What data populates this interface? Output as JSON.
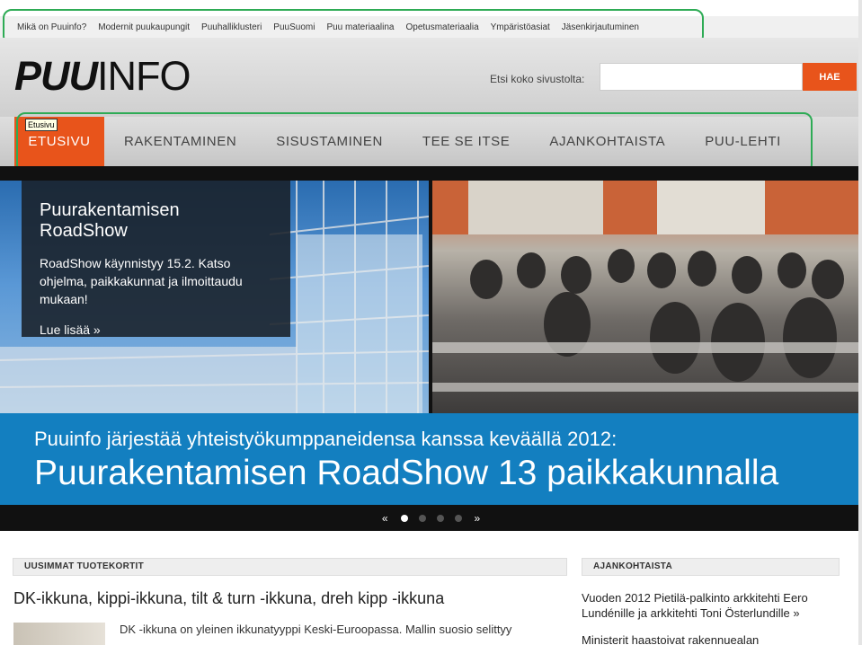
{
  "top_links": [
    "Mikä on Puuinfo?",
    "Modernit puukaupungit",
    "Puuhalliklusteri",
    "PuuSuomi",
    "Puu materiaalina",
    "Opetusmateriaalia",
    "Ympäristöasiat",
    "Jäsenkirjautuminen"
  ],
  "header": {
    "logo_part1": "PUU",
    "logo_part2": "INFO",
    "search_label": "Etsi koko sivustolta:",
    "search_value": "",
    "search_button": "HAE"
  },
  "main_nav": {
    "active": "ETUSIVU",
    "items": [
      "RAKENTAMINEN",
      "SISUSTAMINEN",
      "TEE SE ITSE",
      "AJANKOHTAISTA",
      "PUU-LEHTI"
    ],
    "tooltip": "Etusivu"
  },
  "hero": {
    "title": "Puurakentamisen RoadShow",
    "text": "RoadShow käynnistyy 15.2. Katso ohjelma, paikkakunnat ja ilmoittaudu mukaan!",
    "more": "Lue lisää »",
    "banner_line1": "Puuinfo järjestää yhteistyökumppaneidensa kanssa keväällä 2012:",
    "banner_line2": "Puurakentamisen RoadShow 13 paikkakunnalla",
    "pager_prev": "«",
    "pager_next": "»",
    "slide_count": 4,
    "active_slide": 1
  },
  "latest": {
    "heading": "UUSIMMAT TUOTEKORTIT",
    "article_title": "DK-ikkuna, kippi-ikkuna, tilt & turn -ikkuna, dreh kipp -ikkuna",
    "article_text": "DK -ikkuna on yleinen ikkunatyyppi Keski-Euroopassa. Mallin suosio selittyy"
  },
  "news": {
    "heading": "AJANKOHTAISTA",
    "item1": "Vuoden 2012 Pietilä-palkinto arkkitehti Eero Lundénille ja arkkitehti Toni Österlundille »",
    "item2": "Ministerit haastoivat rakennuealan"
  },
  "colors": {
    "accent": "#e8541b",
    "banner_blue": "#137fc0",
    "annotation_green": "#2eab55"
  }
}
